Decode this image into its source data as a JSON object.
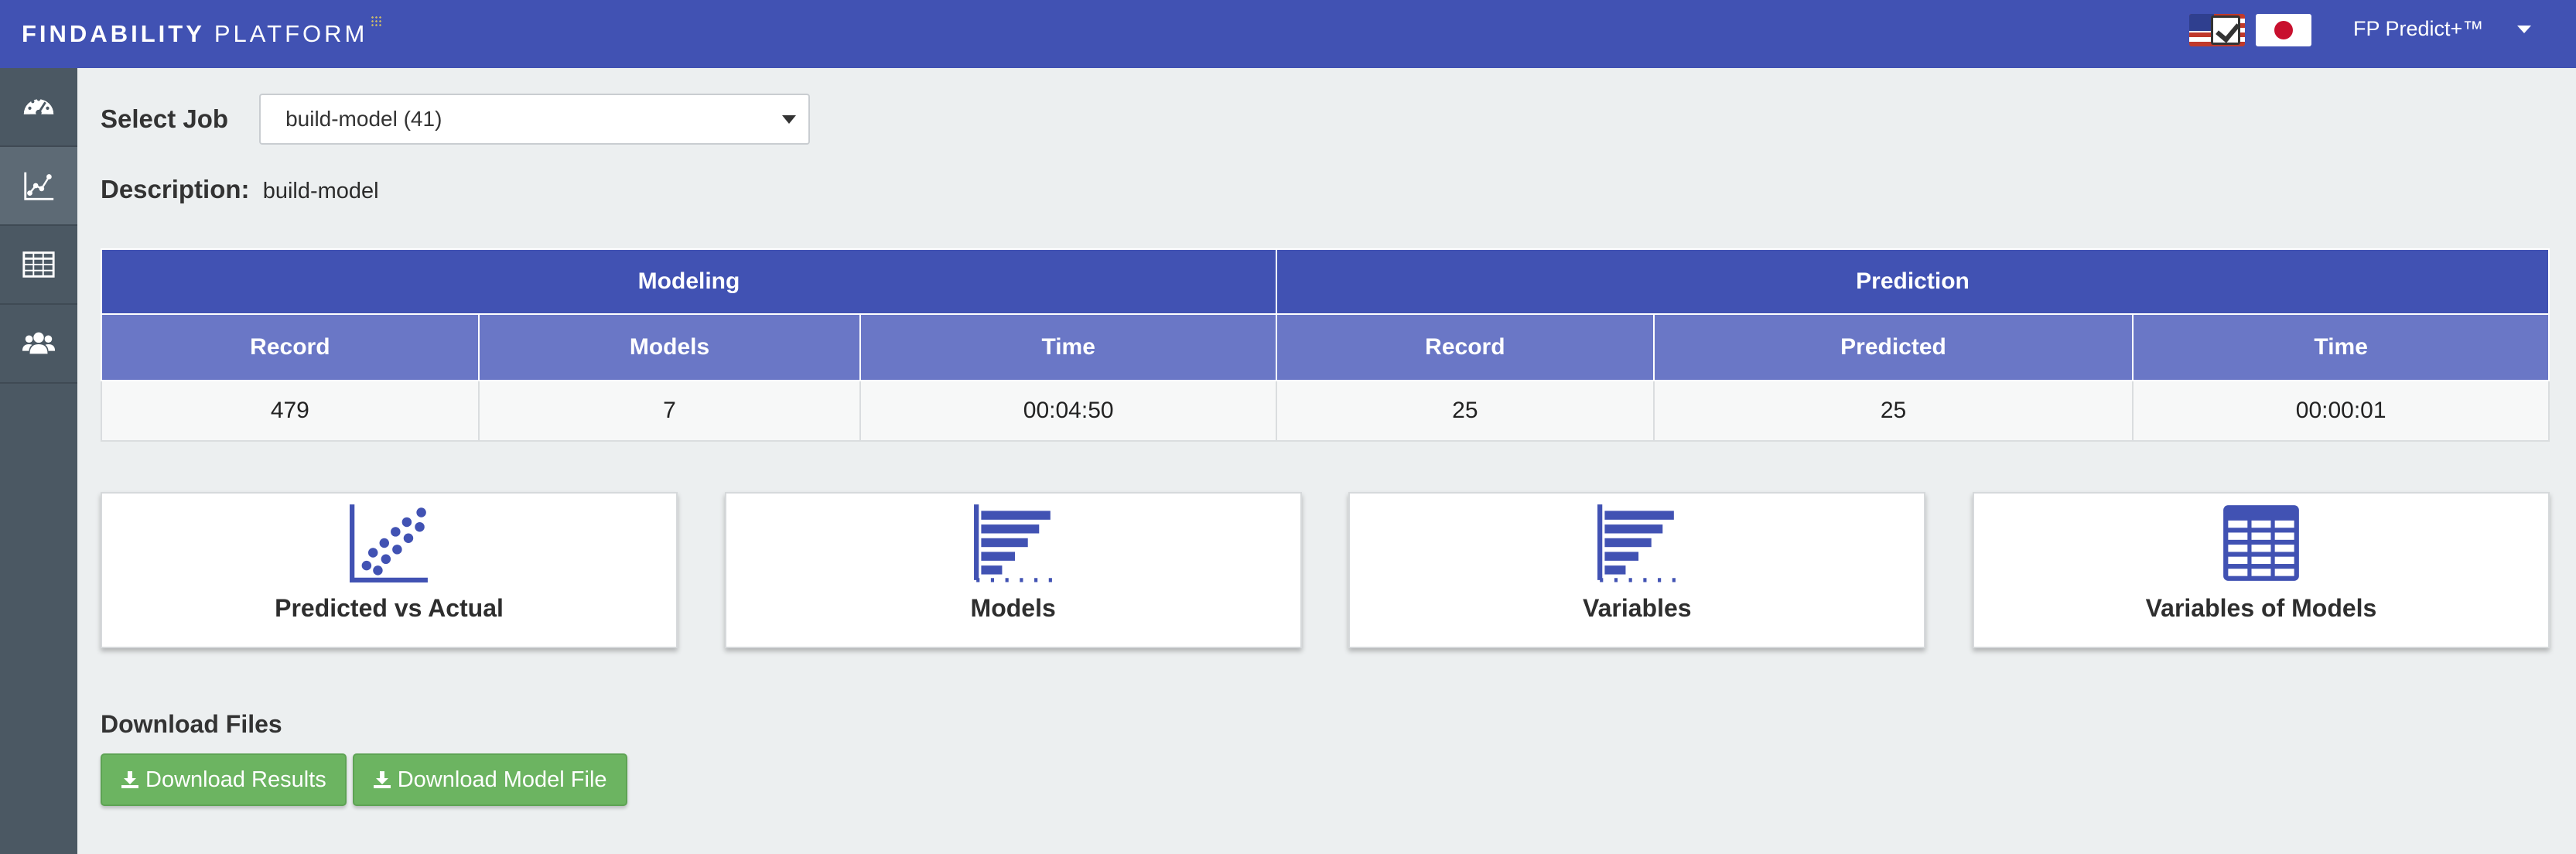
{
  "header": {
    "logo_primary": "FINDABILITY",
    "logo_secondary": "PLATFORM",
    "product_name": "FP Predict+™",
    "flags": [
      "us-flag-icon",
      "japan-flag-icon"
    ]
  },
  "sidebar": {
    "items": [
      {
        "icon": "dashboard-icon"
      },
      {
        "icon": "line-chart-icon",
        "active": true
      },
      {
        "icon": "table-icon"
      },
      {
        "icon": "users-icon"
      }
    ]
  },
  "job": {
    "label": "Select Job",
    "selected": "build-model (41)"
  },
  "description": {
    "label": "Description:",
    "value": "build-model"
  },
  "stats_table": {
    "groups": [
      "Modeling",
      "Prediction"
    ],
    "columns": [
      "Record",
      "Models",
      "Time",
      "Record",
      "Predicted",
      "Time"
    ],
    "values": [
      "479",
      "7",
      "00:04:50",
      "25",
      "25",
      "00:00:01"
    ]
  },
  "cards": [
    {
      "label": "Predicted vs Actual",
      "icon": "scatter-plot-icon"
    },
    {
      "label": "Models",
      "icon": "bar-chart-icon"
    },
    {
      "label": "Variables",
      "icon": "bar-chart-icon"
    },
    {
      "label": "Variables of Models",
      "icon": "grid-table-icon"
    }
  ],
  "downloads": {
    "title": "Download Files",
    "buttons": [
      "Download Results",
      "Download Model File"
    ]
  },
  "colors": {
    "primary": "#4152b3",
    "secondary_header": "#6a77c6",
    "sidebar": "#4b5863",
    "button_green": "#6cb461",
    "background": "#eceff0"
  }
}
